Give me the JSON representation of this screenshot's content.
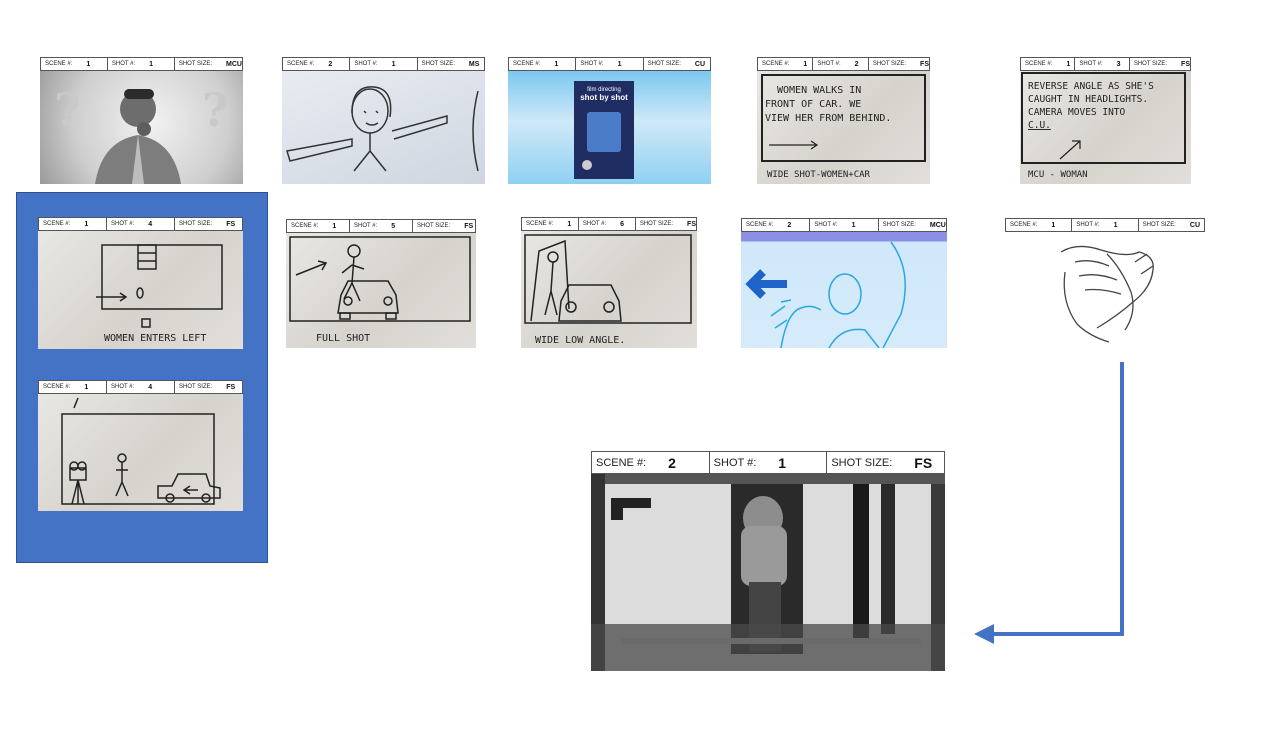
{
  "labels": {
    "scene": "SCENE #:",
    "shot": "SHOT #:",
    "size": "SHOT SIZE:"
  },
  "colors": {
    "panel": "#4472c4",
    "connector": "#4472c4"
  },
  "cards": [
    {
      "id": "c1",
      "scene": "1",
      "shot": "1",
      "size": "MCU"
    },
    {
      "id": "c2",
      "scene": "2",
      "shot": "1",
      "size": "MS"
    },
    {
      "id": "c3",
      "scene": "1",
      "shot": "1",
      "size": "CU"
    },
    {
      "id": "c4",
      "scene": "1",
      "shot": "2",
      "size": "FS"
    },
    {
      "id": "c5",
      "scene": "1",
      "shot": "3",
      "size": "FS"
    },
    {
      "id": "c6",
      "scene": "1",
      "shot": "4",
      "size": "FS"
    },
    {
      "id": "c7",
      "scene": "1",
      "shot": "5",
      "size": "FS"
    },
    {
      "id": "c8",
      "scene": "1",
      "shot": "6",
      "size": "FS"
    },
    {
      "id": "c9",
      "scene": "2",
      "shot": "1",
      "size": "MCU"
    },
    {
      "id": "c10",
      "scene": "1",
      "shot": "1",
      "size": "CU"
    },
    {
      "id": "c11",
      "scene": "1",
      "shot": "4",
      "size": "FS"
    },
    {
      "id": "c12",
      "scene": "2",
      "shot": "1",
      "size": "FS"
    }
  ],
  "sketch_text": {
    "book_small": "film directing",
    "book_title": "shot by shot",
    "c4_note": "WOMEN WALKS IN\nFRONT OF CAR. WE\nVIEW HER FROM BEHIND.",
    "c4_caption": "WIDE SHOT-WOMEN+CAR",
    "c5_note": "REVERSE ANGLE AS SHE'S\nCAUGHT IN HEADLIGHTS.\nCAMERA MOVES INTO\nC.U.",
    "c5_caption": "MCU - WOMAN",
    "c6_caption": "WOMEN ENTERS LEFT",
    "c7_caption": "FULL SHOT",
    "c8_caption": "WIDE LOW ANGLE."
  }
}
